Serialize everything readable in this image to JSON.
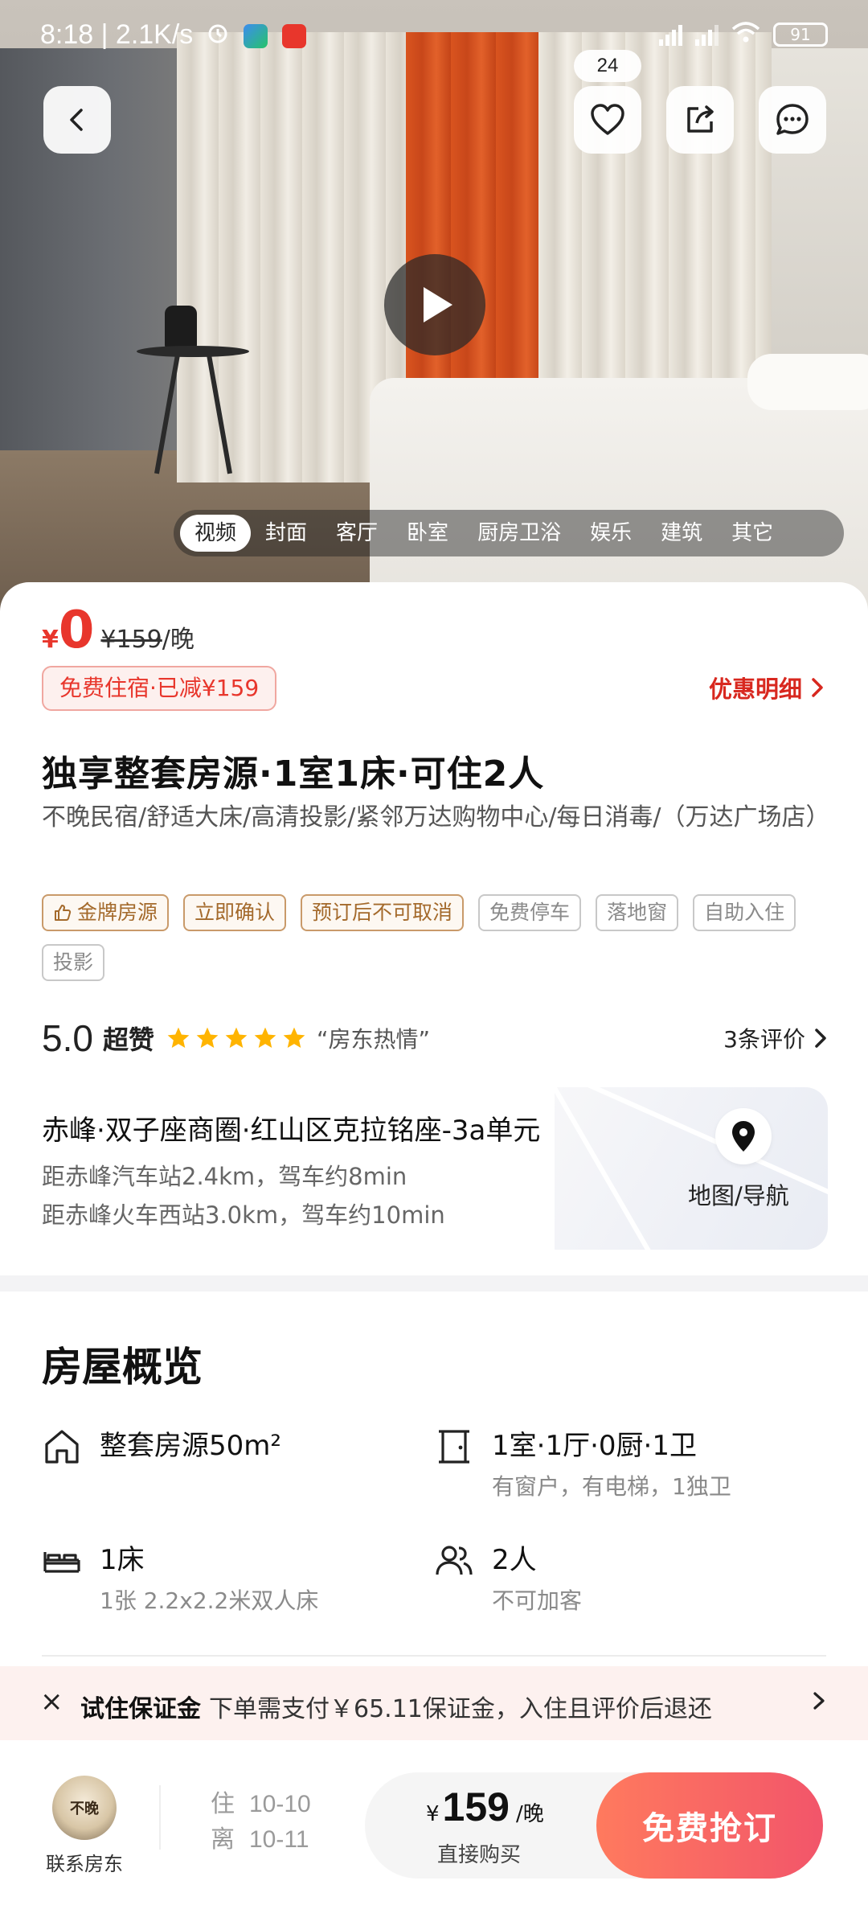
{
  "status": {
    "time": "8:18",
    "speed": "2.1K/s",
    "battery": "91"
  },
  "favorites_count": "24",
  "photo_tabs": [
    "视频",
    "封面",
    "客厅",
    "卧室",
    "厨房卫浴",
    "娱乐",
    "建筑",
    "其它"
  ],
  "price": {
    "currency": "¥",
    "now": "0",
    "original": "¥159",
    "per_night": "/晚"
  },
  "free_stay_badge": "免费住宿·已减¥159",
  "discount_detail": "优惠明细",
  "title": "独享整套房源·1室1床·可住2人",
  "subtitle": "不晚民宿/舒适大床/高清投影/紧邻万达购物中心/每日消毒/（万达广场店）",
  "tags": [
    {
      "label": "金牌房源",
      "style": "gold",
      "icon": "thumbs-up-icon"
    },
    {
      "label": "立即确认",
      "style": "gold"
    },
    {
      "label": "预订后不可取消",
      "style": "gold"
    },
    {
      "label": "免费停车",
      "style": "grey"
    },
    {
      "label": "落地窗",
      "style": "grey"
    },
    {
      "label": "自助入住",
      "style": "grey"
    },
    {
      "label": "投影",
      "style": "grey"
    }
  ],
  "rating": {
    "score": "5.0",
    "label": "超赞",
    "stars": 5,
    "quote": "“房东热情”",
    "reviews": "3条评价"
  },
  "location": {
    "address": "赤峰·双子座商圈·红山区克拉铭座-3a单元",
    "distance1": "距赤峰汽车站2.4km，驾车约8min",
    "distance2": "距赤峰火车西站3.0km，驾车约10min",
    "map_label": "地图/导航"
  },
  "overview": {
    "title": "房屋概览",
    "area_main": "整套房源50m²",
    "rooms_main": "1室·1厅·0厨·1卫",
    "rooms_sub": "有窗户，有电梯，1独卫",
    "beds_main": "1床",
    "beds_sub": "1张 2.2x2.2米双人床",
    "guests_main": "2人",
    "guests_sub": "不可加客"
  },
  "deposit": {
    "close": "×",
    "title": "试住保证金",
    "text": "下单需支付￥65.11保证金，入住且评价后退还"
  },
  "bottom": {
    "host_avatar_text": "不晚",
    "host_label": "联系房东",
    "checkin_label": "住",
    "checkin_date": "10-10",
    "checkout_label": "离",
    "checkout_date": "10-11",
    "buy_currency": "¥",
    "buy_price": "159",
    "buy_unit": "/晚",
    "buy_sub": "直接购买",
    "book_label": "免费抢订"
  },
  "colors": {
    "accent_red": "#e8362c",
    "book_gradient_start": "#ff7a5e",
    "book_gradient_end": "#f2556a",
    "gold_tag": "#a46a2c",
    "star": "#ffb400"
  }
}
